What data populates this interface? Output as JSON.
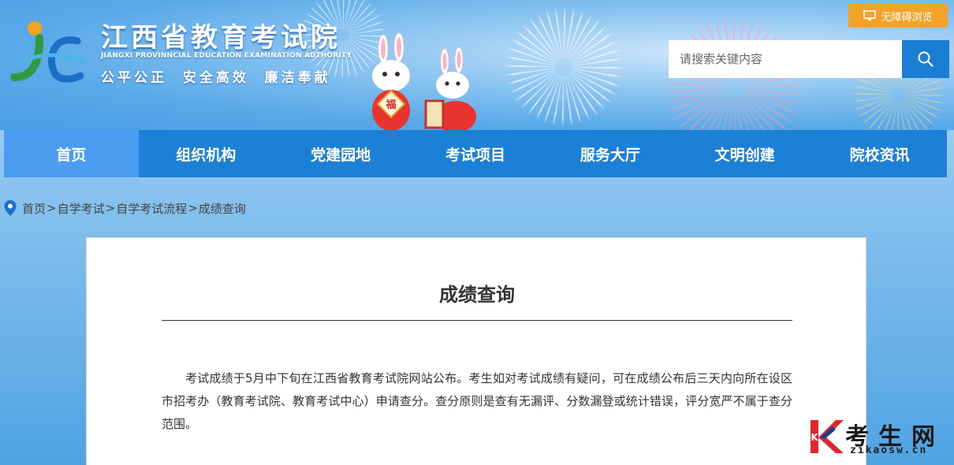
{
  "header": {
    "title": "江西省教育考试院",
    "subtitle": "JIANGXI PROVINNCIAL EDUCATION EXAMINATION AUTHORITY",
    "motto": "公平公正  安全高效  廉洁奉献",
    "accessibility_label": "无障碍浏览",
    "search_placeholder": "请搜索关键内容",
    "logo_icon": "jx-logo-icon",
    "mascot_badge": "福"
  },
  "nav": {
    "items": [
      "首页",
      "组织机构",
      "党建园地",
      "考试项目",
      "服务大厅",
      "文明创建",
      "院校资讯"
    ],
    "active_index": 0
  },
  "breadcrumb": {
    "items": [
      "首页",
      "自学考试",
      "自学考试流程",
      "成绩查询"
    ],
    "separator": ">"
  },
  "article": {
    "title": "成绩查询",
    "body": "考试成绩于5月中下旬在江西省教育考试院网站公布。考生如对考试成绩有疑问，可在成绩公布后三天内向所在设区市招考办（教育考试院、教育考试中心）申请查分。查分原则是查有无漏评、分数漏登或统计错误，评分宽严不属于查分范围。"
  },
  "watermark": {
    "brand": "考生网",
    "domain": "zikaosw.cn",
    "logo_letter": "K"
  },
  "colors": {
    "nav_bg": "#1b80d6",
    "nav_active": "#4a9df0",
    "accessibility_btn": "#f4a227",
    "search_btn": "#1a7fd4",
    "watermark_red": "#e0262f"
  }
}
